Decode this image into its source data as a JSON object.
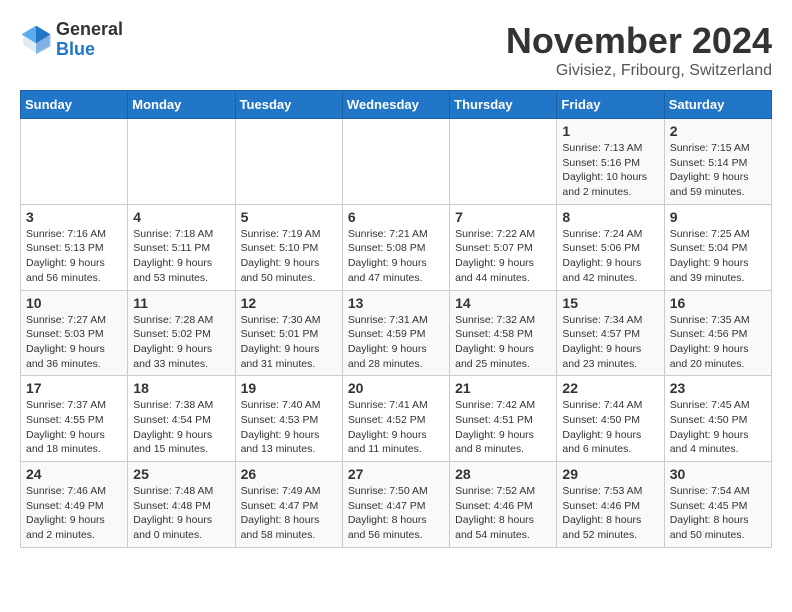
{
  "logo": {
    "general": "General",
    "blue": "Blue"
  },
  "title": "November 2024",
  "location": "Givisiez, Fribourg, Switzerland",
  "days_of_week": [
    "Sunday",
    "Monday",
    "Tuesday",
    "Wednesday",
    "Thursday",
    "Friday",
    "Saturday"
  ],
  "weeks": [
    [
      {
        "day": "",
        "info": ""
      },
      {
        "day": "",
        "info": ""
      },
      {
        "day": "",
        "info": ""
      },
      {
        "day": "",
        "info": ""
      },
      {
        "day": "",
        "info": ""
      },
      {
        "day": "1",
        "info": "Sunrise: 7:13 AM\nSunset: 5:16 PM\nDaylight: 10 hours\nand 2 minutes."
      },
      {
        "day": "2",
        "info": "Sunrise: 7:15 AM\nSunset: 5:14 PM\nDaylight: 9 hours\nand 59 minutes."
      }
    ],
    [
      {
        "day": "3",
        "info": "Sunrise: 7:16 AM\nSunset: 5:13 PM\nDaylight: 9 hours\nand 56 minutes."
      },
      {
        "day": "4",
        "info": "Sunrise: 7:18 AM\nSunset: 5:11 PM\nDaylight: 9 hours\nand 53 minutes."
      },
      {
        "day": "5",
        "info": "Sunrise: 7:19 AM\nSunset: 5:10 PM\nDaylight: 9 hours\nand 50 minutes."
      },
      {
        "day": "6",
        "info": "Sunrise: 7:21 AM\nSunset: 5:08 PM\nDaylight: 9 hours\nand 47 minutes."
      },
      {
        "day": "7",
        "info": "Sunrise: 7:22 AM\nSunset: 5:07 PM\nDaylight: 9 hours\nand 44 minutes."
      },
      {
        "day": "8",
        "info": "Sunrise: 7:24 AM\nSunset: 5:06 PM\nDaylight: 9 hours\nand 42 minutes."
      },
      {
        "day": "9",
        "info": "Sunrise: 7:25 AM\nSunset: 5:04 PM\nDaylight: 9 hours\nand 39 minutes."
      }
    ],
    [
      {
        "day": "10",
        "info": "Sunrise: 7:27 AM\nSunset: 5:03 PM\nDaylight: 9 hours\nand 36 minutes."
      },
      {
        "day": "11",
        "info": "Sunrise: 7:28 AM\nSunset: 5:02 PM\nDaylight: 9 hours\nand 33 minutes."
      },
      {
        "day": "12",
        "info": "Sunrise: 7:30 AM\nSunset: 5:01 PM\nDaylight: 9 hours\nand 31 minutes."
      },
      {
        "day": "13",
        "info": "Sunrise: 7:31 AM\nSunset: 4:59 PM\nDaylight: 9 hours\nand 28 minutes."
      },
      {
        "day": "14",
        "info": "Sunrise: 7:32 AM\nSunset: 4:58 PM\nDaylight: 9 hours\nand 25 minutes."
      },
      {
        "day": "15",
        "info": "Sunrise: 7:34 AM\nSunset: 4:57 PM\nDaylight: 9 hours\nand 23 minutes."
      },
      {
        "day": "16",
        "info": "Sunrise: 7:35 AM\nSunset: 4:56 PM\nDaylight: 9 hours\nand 20 minutes."
      }
    ],
    [
      {
        "day": "17",
        "info": "Sunrise: 7:37 AM\nSunset: 4:55 PM\nDaylight: 9 hours\nand 18 minutes."
      },
      {
        "day": "18",
        "info": "Sunrise: 7:38 AM\nSunset: 4:54 PM\nDaylight: 9 hours\nand 15 minutes."
      },
      {
        "day": "19",
        "info": "Sunrise: 7:40 AM\nSunset: 4:53 PM\nDaylight: 9 hours\nand 13 minutes."
      },
      {
        "day": "20",
        "info": "Sunrise: 7:41 AM\nSunset: 4:52 PM\nDaylight: 9 hours\nand 11 minutes."
      },
      {
        "day": "21",
        "info": "Sunrise: 7:42 AM\nSunset: 4:51 PM\nDaylight: 9 hours\nand 8 minutes."
      },
      {
        "day": "22",
        "info": "Sunrise: 7:44 AM\nSunset: 4:50 PM\nDaylight: 9 hours\nand 6 minutes."
      },
      {
        "day": "23",
        "info": "Sunrise: 7:45 AM\nSunset: 4:50 PM\nDaylight: 9 hours\nand 4 minutes."
      }
    ],
    [
      {
        "day": "24",
        "info": "Sunrise: 7:46 AM\nSunset: 4:49 PM\nDaylight: 9 hours\nand 2 minutes."
      },
      {
        "day": "25",
        "info": "Sunrise: 7:48 AM\nSunset: 4:48 PM\nDaylight: 9 hours\nand 0 minutes."
      },
      {
        "day": "26",
        "info": "Sunrise: 7:49 AM\nSunset: 4:47 PM\nDaylight: 8 hours\nand 58 minutes."
      },
      {
        "day": "27",
        "info": "Sunrise: 7:50 AM\nSunset: 4:47 PM\nDaylight: 8 hours\nand 56 minutes."
      },
      {
        "day": "28",
        "info": "Sunrise: 7:52 AM\nSunset: 4:46 PM\nDaylight: 8 hours\nand 54 minutes."
      },
      {
        "day": "29",
        "info": "Sunrise: 7:53 AM\nSunset: 4:46 PM\nDaylight: 8 hours\nand 52 minutes."
      },
      {
        "day": "30",
        "info": "Sunrise: 7:54 AM\nSunset: 4:45 PM\nDaylight: 8 hours\nand 50 minutes."
      }
    ]
  ]
}
